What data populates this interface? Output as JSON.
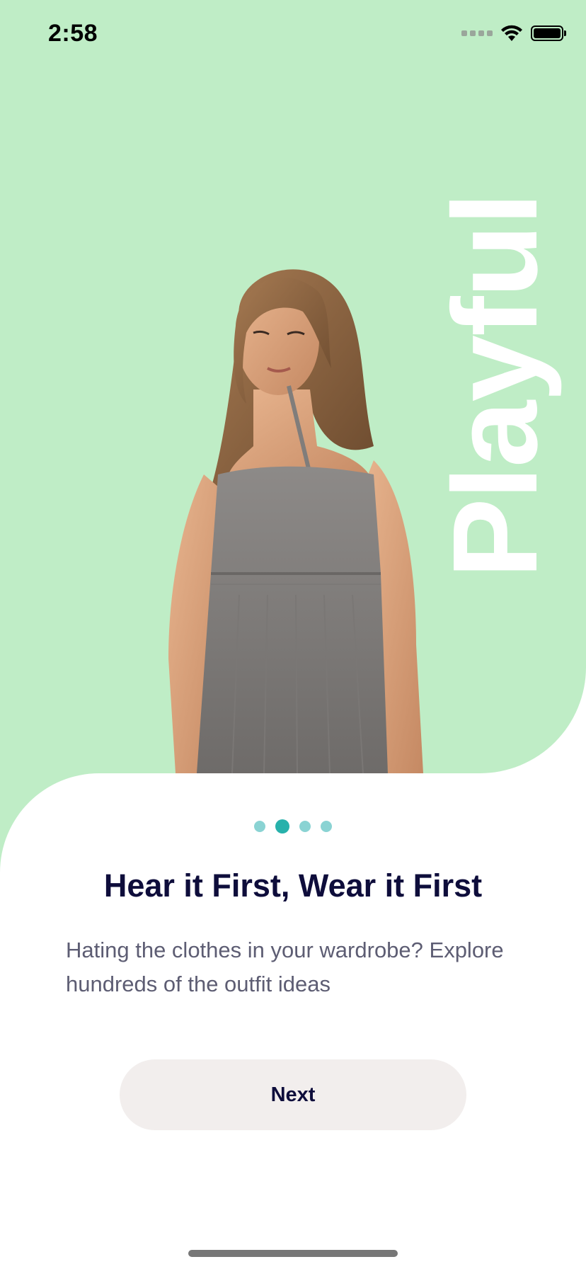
{
  "status_bar": {
    "time": "2:58",
    "icons": [
      "signal-dots-icon",
      "wifi-icon",
      "battery-icon"
    ]
  },
  "hero": {
    "vertical_word": "Playful",
    "background_color": "#bfedc6",
    "image": "woman-in-grey-dress-photo"
  },
  "pager": {
    "total": 4,
    "active_index": 1,
    "active_color": "#27b1ab",
    "inactive_color": "#8ad3d3"
  },
  "content": {
    "headline": "Hear it First, Wear it First",
    "description": "Hating the clothes in your wardrobe? Explore hundreds of the outfit ideas"
  },
  "actions": {
    "next_label": "Next"
  }
}
